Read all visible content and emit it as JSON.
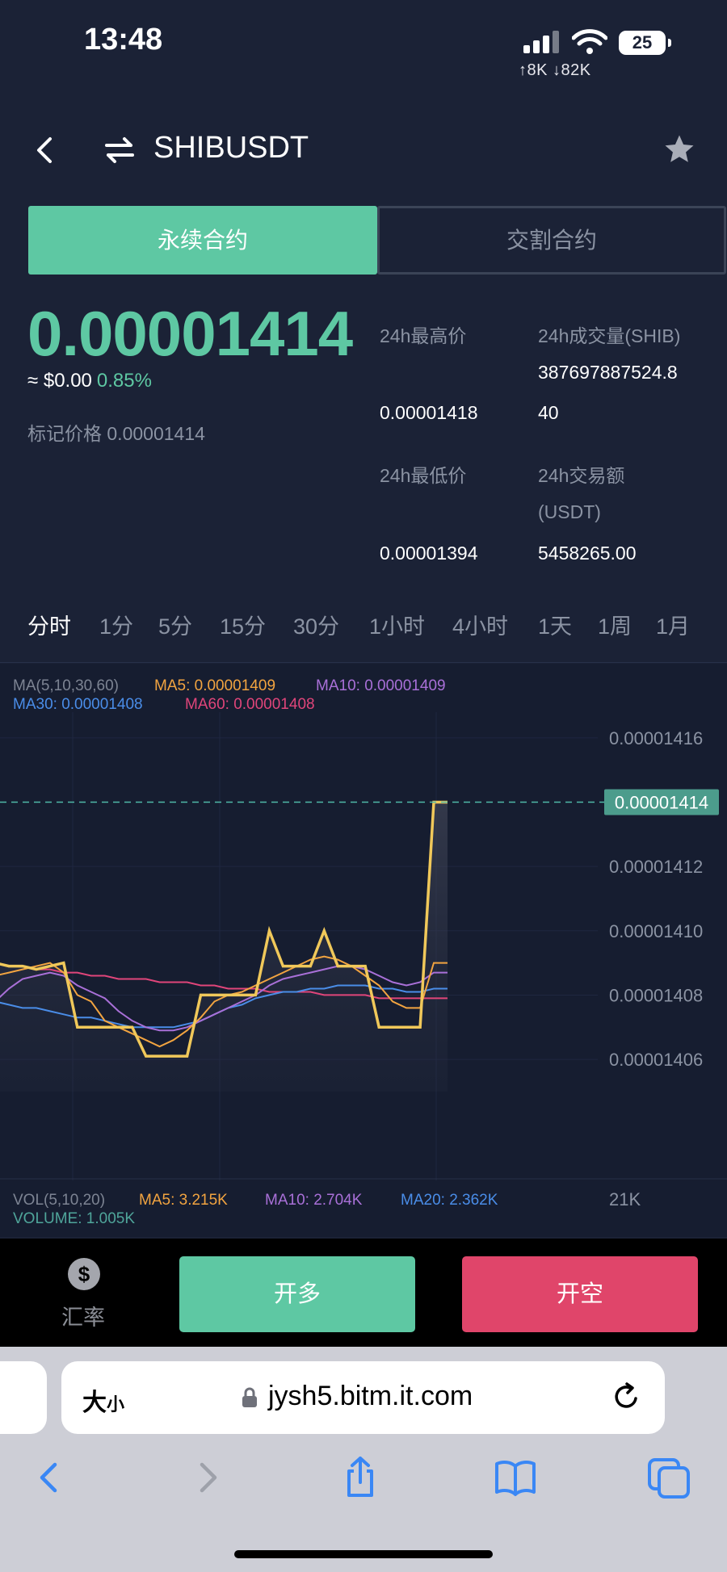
{
  "status_bar": {
    "time": "13:48",
    "battery": "25",
    "network": "↑8K ↓82K"
  },
  "header": {
    "pair": "SHIBUSDT"
  },
  "contract_tabs": {
    "perpetual": "永续合约",
    "delivery": "交割合约"
  },
  "ticker": {
    "last_price": "0.00001414",
    "usd_value": "≈ $0.00",
    "change_pct": "0.85%",
    "mark_price": "标记价格 0.00001414",
    "high_label": "24h最高价",
    "high_value": "0.00001418",
    "low_label": "24h最低价",
    "low_value": "0.00001394",
    "volume_label": "24h成交量(SHIB)",
    "volume_value_line1": "387697887524.8",
    "volume_value_line2": "40",
    "turnover_label_line1": "24h交易额",
    "turnover_label_line2": "(USDT)",
    "turnover_value": "5458265.00"
  },
  "intervals": [
    "分时",
    "1分",
    "5分",
    "15分",
    "30分",
    "1小时",
    "4小时",
    "1天",
    "1周",
    "1月"
  ],
  "active_interval": 0,
  "chart_data": {
    "type": "line",
    "ma_legend": {
      "title": "MA(5,10,30,60)",
      "ma5": "MA5: 0.00001409",
      "ma10": "MA10: 0.00001409",
      "ma30": "MA30: 0.00001408",
      "ma60": "MA60: 0.00001408"
    },
    "vol_legend": {
      "title": "VOL(5,10,20)",
      "ma5": "MA5: 3.215K",
      "ma10": "MA10: 2.704K",
      "ma20": "MA20: 2.362K",
      "volume": "VOLUME: 1.005K",
      "axis_label": "21K"
    },
    "y_ticks": [
      "0.00001416",
      "0.00001414",
      "0.00001412",
      "0.00001410",
      "0.00001408",
      "0.00001406"
    ],
    "y_tick_values": [
      1.416e-05,
      1.412e-05,
      1.41e-05,
      1.408e-05,
      1.406e-05
    ],
    "current_price_label": "0.00001414",
    "current_price": 1.414e-05,
    "ylim": [
      1.4055e-05,
      1.41685e-05
    ],
    "n_points": 34,
    "colors": {
      "price": "#f0c85a",
      "ma5": "#f2a440",
      "ma10": "#a970d8",
      "ma30": "#4a8de8",
      "ma60": "#e0457a",
      "current": "#4fb9a8"
    },
    "series": [
      {
        "name": "price",
        "values": [
          1.409e-05,
          1.4089e-05,
          1.4089e-05,
          1.4088e-05,
          1.4089e-05,
          1.409e-05,
          1.407e-05,
          1.407e-05,
          1.407e-05,
          1.407e-05,
          1.407e-05,
          1.4061e-05,
          1.4061e-05,
          1.4061e-05,
          1.4061e-05,
          1.408e-05,
          1.408e-05,
          1.408e-05,
          1.408e-05,
          1.408e-05,
          1.41e-05,
          1.4089e-05,
          1.4089e-05,
          1.4089e-05,
          1.41e-05,
          1.4089e-05,
          1.4089e-05,
          1.4089e-05,
          1.407e-05,
          1.407e-05,
          1.407e-05,
          1.407e-05,
          1.414e-05,
          1.414e-05
        ]
      },
      {
        "name": "MA5",
        "values": [
          1.4086e-05,
          1.4087e-05,
          1.4088e-05,
          1.4089e-05,
          1.409e-05,
          1.4087e-05,
          1.408e-05,
          1.4078e-05,
          1.4072e-05,
          1.407e-05,
          1.4068e-05,
          1.4066e-05,
          1.4064e-05,
          1.4066e-05,
          1.4069e-05,
          1.4073e-05,
          1.4078e-05,
          1.408e-05,
          1.4081e-05,
          1.4083e-05,
          1.4085e-05,
          1.4087e-05,
          1.4089e-05,
          1.4091e-05,
          1.4092e-05,
          1.4091e-05,
          1.4089e-05,
          1.4086e-05,
          1.4083e-05,
          1.4078e-05,
          1.4076e-05,
          1.4076e-05,
          1.409e-05,
          1.409e-05
        ]
      },
      {
        "name": "MA10",
        "values": [
          1.4078e-05,
          1.4082e-05,
          1.4085e-05,
          1.4086e-05,
          1.4087e-05,
          1.4086e-05,
          1.4083e-05,
          1.4081e-05,
          1.4079e-05,
          1.4075e-05,
          1.4072e-05,
          1.407e-05,
          1.4069e-05,
          1.4069e-05,
          1.407e-05,
          1.4072e-05,
          1.4074e-05,
          1.4076e-05,
          1.4078e-05,
          1.408e-05,
          1.4083e-05,
          1.4085e-05,
          1.4086e-05,
          1.4087e-05,
          1.4088e-05,
          1.4089e-05,
          1.4089e-05,
          1.4088e-05,
          1.4086e-05,
          1.4084e-05,
          1.4083e-05,
          1.4084e-05,
          1.4087e-05,
          1.4087e-05
        ]
      },
      {
        "name": "MA30",
        "values": [
          1.4078e-05,
          1.4077e-05,
          1.4076e-05,
          1.4076e-05,
          1.4075e-05,
          1.4074e-05,
          1.4073e-05,
          1.4073e-05,
          1.4072e-05,
          1.4071e-05,
          1.407e-05,
          1.407e-05,
          1.407e-05,
          1.407e-05,
          1.4071e-05,
          1.4072e-05,
          1.4074e-05,
          1.4076e-05,
          1.4077e-05,
          1.4079e-05,
          1.408e-05,
          1.4081e-05,
          1.4081e-05,
          1.4082e-05,
          1.4082e-05,
          1.4083e-05,
          1.4083e-05,
          1.4083e-05,
          1.4082e-05,
          1.4082e-05,
          1.4081e-05,
          1.4081e-05,
          1.4082e-05,
          1.4082e-05
        ]
      },
      {
        "name": "MA60",
        "values": [
          1.409e-05,
          1.4089e-05,
          1.4089e-05,
          1.4088e-05,
          1.4088e-05,
          1.4087e-05,
          1.4087e-05,
          1.4086e-05,
          1.4086e-05,
          1.4085e-05,
          1.4085e-05,
          1.4085e-05,
          1.4084e-05,
          1.4084e-05,
          1.4084e-05,
          1.4083e-05,
          1.4083e-05,
          1.4082e-05,
          1.4082e-05,
          1.4082e-05,
          1.4081e-05,
          1.4081e-05,
          1.4081e-05,
          1.4081e-05,
          1.408e-05,
          1.408e-05,
          1.408e-05,
          1.408e-05,
          1.4079e-05,
          1.4079e-05,
          1.4079e-05,
          1.4079e-05,
          1.4079e-05,
          1.4079e-05
        ]
      }
    ]
  },
  "actions": {
    "rate_label": "汇率",
    "rate_symbol": "$",
    "buy_label": "开多",
    "sell_label": "开空"
  },
  "browser": {
    "text_size": "大",
    "text_size_small": "小",
    "url": "jysh5.bitm.it.com"
  }
}
